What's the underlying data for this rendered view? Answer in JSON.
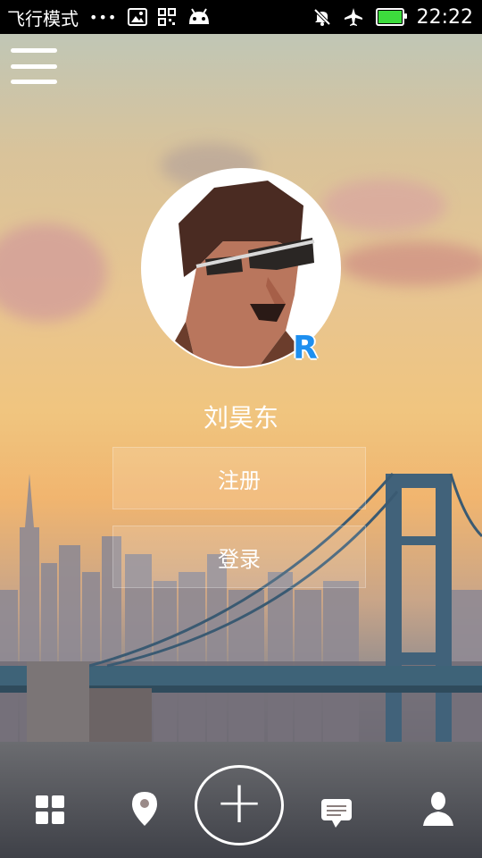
{
  "status_bar": {
    "airplane_text": "飞行模式",
    "dots": "•••",
    "time": "22:22",
    "battery_color": "#3ddc3d",
    "icons": [
      "image-icon",
      "grid-dots-icon",
      "android-icon",
      "mute-icon",
      "airplane-icon",
      "battery-icon"
    ]
  },
  "profile": {
    "name": "刘昊东",
    "badge": "R"
  },
  "buttons": {
    "register": "注册",
    "login": "登录"
  },
  "bottom_nav": {
    "items": [
      "apps-grid-icon",
      "location-pin-icon",
      "add-icon",
      "message-icon",
      "user-icon"
    ],
    "plus_symbol": "+"
  },
  "colors": {
    "badge": "#1d8ff0",
    "text": "#ffffff"
  }
}
